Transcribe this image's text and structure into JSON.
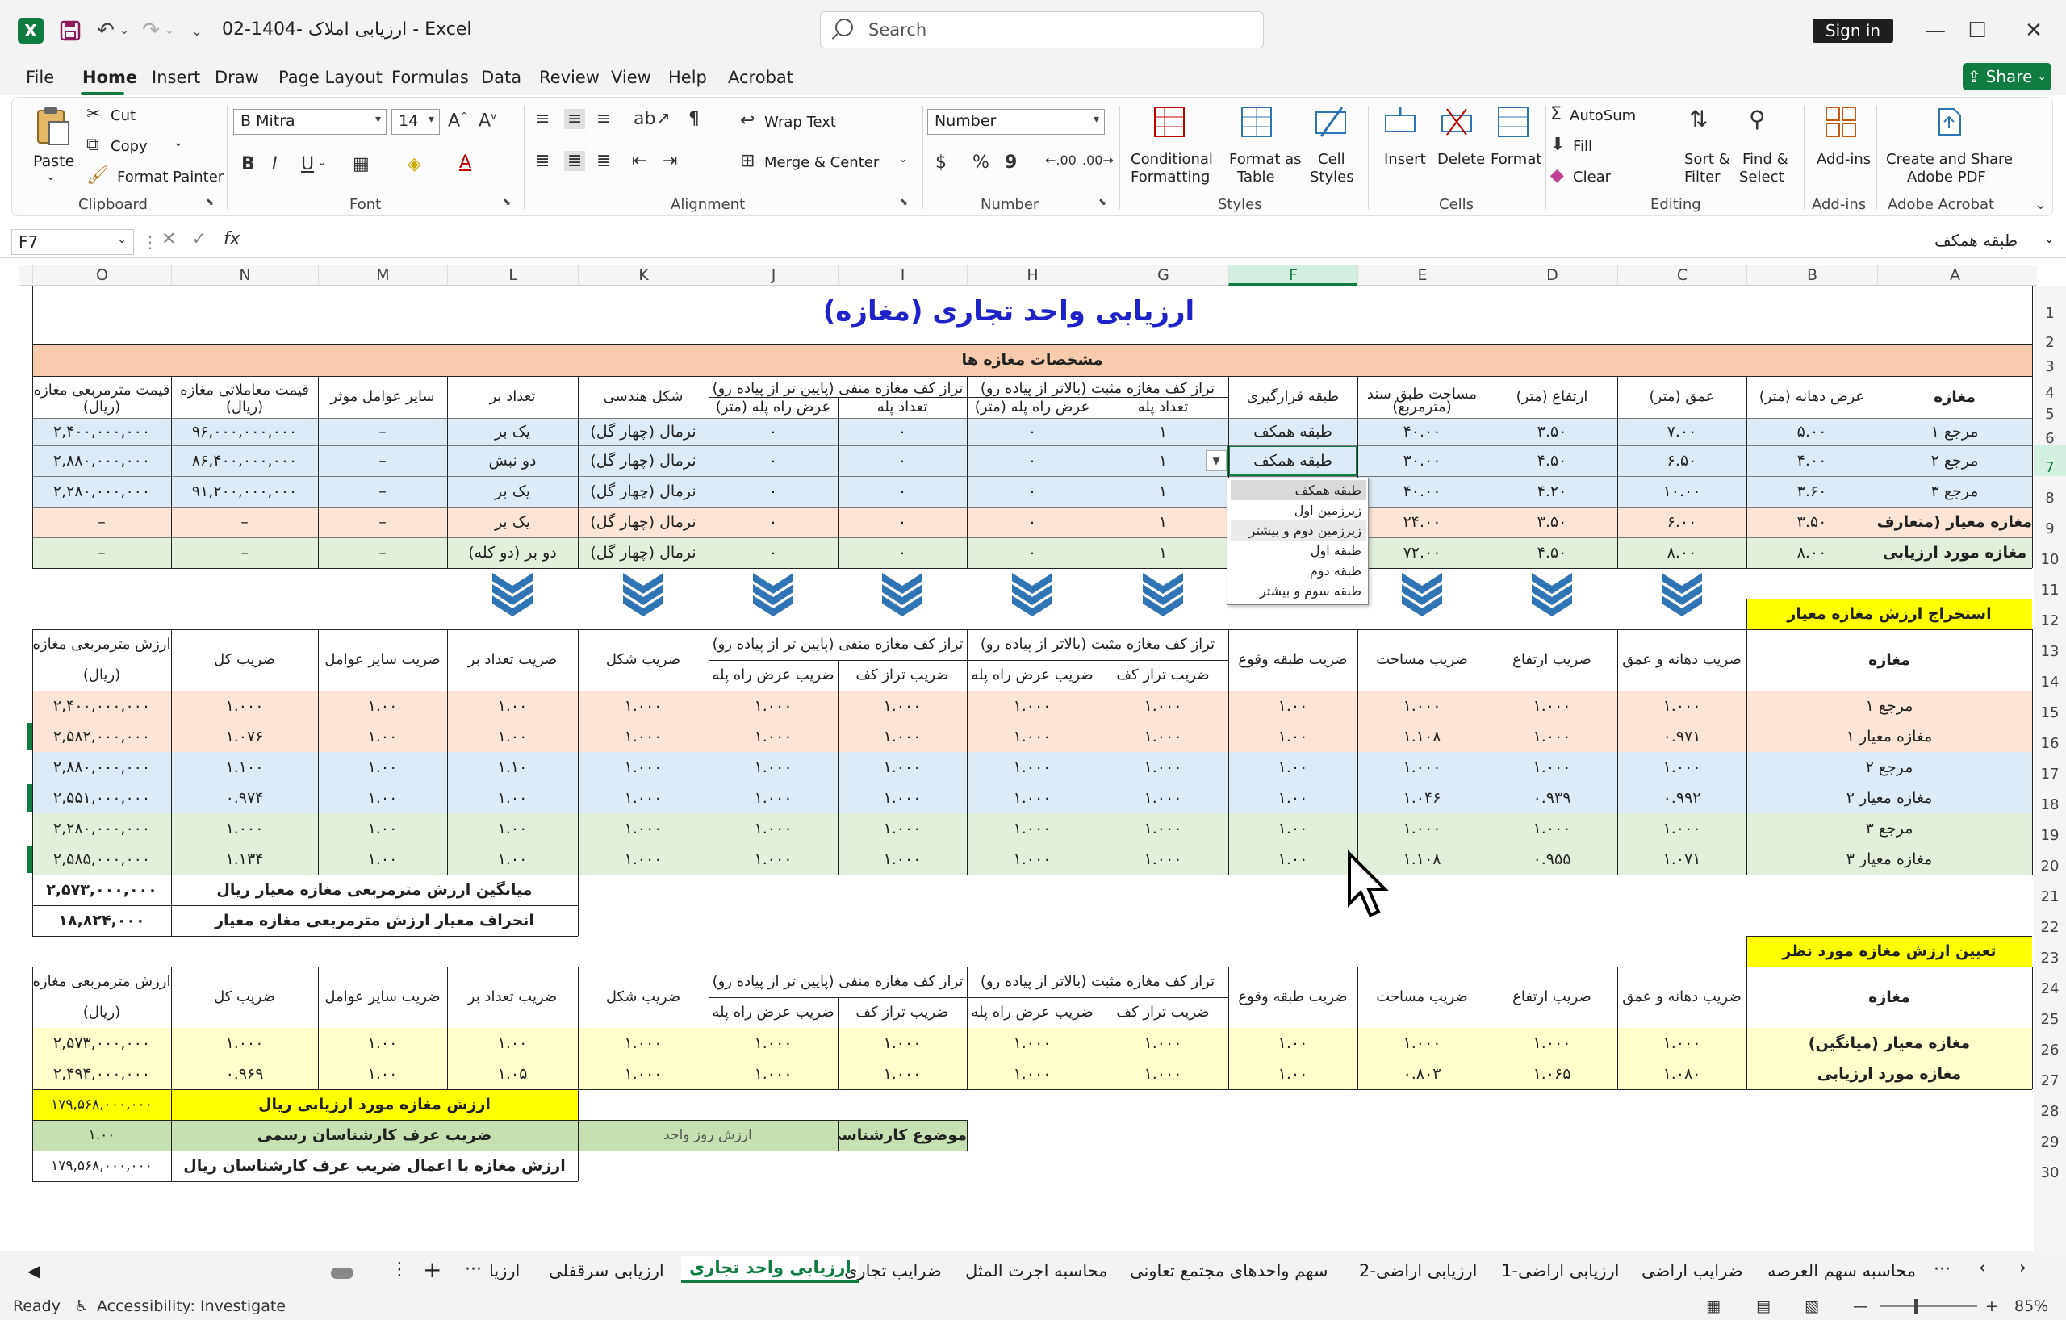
{
  "app": {
    "title": "ارزیابی املاک -1404-02  -  Excel",
    "search_placeholder": "Search",
    "signin_label": "Sign in",
    "share_label": "Share",
    "accent": "#107c41"
  },
  "menu": [
    "File",
    "Home",
    "Insert",
    "Draw",
    "Page Layout",
    "Formulas",
    "Data",
    "Review",
    "View",
    "Help",
    "Acrobat"
  ],
  "ribbon": {
    "clipboard": {
      "paste": "Paste",
      "cut": "Cut",
      "copy": "Copy",
      "format_painter": "Format Painter",
      "group": "Clipboard"
    },
    "font": {
      "name": "B Mitra",
      "size": "14",
      "group": "Font"
    },
    "alignment": {
      "wrap": "Wrap Text",
      "merge": "Merge & Center",
      "group": "Alignment"
    },
    "number": {
      "format": "Number",
      "group": "Number"
    },
    "styles": {
      "conditional": "Conditional",
      "conditional2": "Formatting",
      "format_table": "Format as",
      "format_table2": "Table",
      "cell_styles": "Cell",
      "cell_styles2": "Styles",
      "group": "Styles"
    },
    "cells": {
      "insert": "Insert",
      "delete": "Delete",
      "format": "Format",
      "group": "Cells"
    },
    "editing": {
      "autosum": "AutoSum",
      "fill": "Fill",
      "clear": "Clear",
      "sort": "Sort &",
      "sort2": "Filter",
      "find": "Find &",
      "find2": "Select",
      "group": "Editing"
    },
    "addins": {
      "label": "Add-ins",
      "group": "Add-ins"
    },
    "acrobat": {
      "label": "Create and Share",
      "label2": "Adobe PDF",
      "group": "Adobe Acrobat"
    }
  },
  "formula_bar": {
    "name_box": "F7",
    "fx": "fx",
    "value": "طبقه همکف"
  },
  "columns": [
    "O",
    "N",
    "M",
    "L",
    "K",
    "J",
    "I",
    "H",
    "G",
    "F",
    "E",
    "D",
    "C",
    "B",
    "A"
  ],
  "rows": [
    "1",
    "2",
    "3",
    "4",
    "5",
    "6",
    "7",
    "8",
    "9",
    "10",
    "11",
    "12",
    "13",
    "14",
    "15",
    "16",
    "17",
    "18",
    "19",
    "20",
    "21",
    "22",
    "23",
    "24",
    "25",
    "26",
    "27",
    "28",
    "29",
    "30"
  ],
  "sheet": {
    "title": "ارزیابی واحد تجاری (مغازه)",
    "specs_header": "مشخصات مغازه ها",
    "spec_headers": {
      "shop": "مغازه",
      "frontage": "عرض دهانه (متر)",
      "depth": "عمق (متر)",
      "height": "ارتفاع (متر)",
      "area": "مساحت طبق سند",
      "area_unit": "(مترمربع)",
      "floor": "طبقه قرارگیری",
      "pos_level": "تراز کف مغازه مثبت (بالاتر از پیاده رو)",
      "neg_level": "تراز کف مغازه منفی (پایین تر از پیاده رو)",
      "steps": "تعداد پله",
      "step_width": "عرض راه پله (متر)",
      "shape": "شکل هندسی",
      "sides": "تعداد بر",
      "other": "سایر عوامل موثر",
      "deal_price": "قیمت معاملاتی مغازه",
      "unit_price": "قیمت مترمربعی مغازه",
      "rial": "(ریال)"
    },
    "spec_rows": [
      {
        "shop": "مرجع ۱",
        "frontage": "۵.۰۰",
        "depth": "۷.۰۰",
        "height": "۳.۵۰",
        "area": "۴۰.۰۰",
        "floor": "طبقه همکف",
        "psteps": "۱",
        "pwidth": "۰",
        "nsteps": "۰",
        "nwidth": "۰",
        "shape": "نرمال (چهار گل)",
        "sides": "یک بر",
        "other": "–",
        "deal": "۹۶,۰۰۰,۰۰۰,۰۰۰",
        "unit": "۲,۴۰۰,۰۰۰,۰۰۰"
      },
      {
        "shop": "مرجع ۲",
        "frontage": "۴.۰۰",
        "depth": "۶.۵۰",
        "height": "۴.۵۰",
        "area": "۳۰.۰۰",
        "floor": "طبقه همکف",
        "psteps": "۱",
        "pwidth": "۰",
        "nsteps": "۰",
        "nwidth": "۰",
        "shape": "نرمال (چهار گل)",
        "sides": "دو نبش",
        "other": "–",
        "deal": "۸۶,۴۰۰,۰۰۰,۰۰۰",
        "unit": "۲,۸۸۰,۰۰۰,۰۰۰"
      },
      {
        "shop": "مرجع ۳",
        "frontage": "۳.۶۰",
        "depth": "۱۰.۰۰",
        "height": "۴.۲۰",
        "area": "۴۰.۰۰",
        "floor": "",
        "psteps": "۱",
        "pwidth": "۰",
        "nsteps": "۰",
        "nwidth": "۰",
        "shape": "نرمال (چهار گل)",
        "sides": "یک بر",
        "other": "–",
        "deal": "۹۱,۲۰۰,۰۰۰,۰۰۰",
        "unit": "۲,۲۸۰,۰۰۰,۰۰۰"
      },
      {
        "shop": "مغازه معیار (متعارف)",
        "frontage": "۳.۵۰",
        "depth": "۶.۰۰",
        "height": "۳.۵۰",
        "area": "۲۴.۰۰",
        "floor": "",
        "psteps": "۱",
        "pwidth": "۰",
        "nsteps": "۰",
        "nwidth": "۰",
        "shape": "نرمال (چهار گل)",
        "sides": "یک بر",
        "other": "–",
        "deal": "–",
        "unit": "–"
      },
      {
        "shop": "مغازه مورد ارزیابی",
        "frontage": "۸.۰۰",
        "depth": "۸.۰۰",
        "height": "۴.۵۰",
        "area": "۷۲.۰۰",
        "floor": "",
        "psteps": "۱",
        "pwidth": "۰",
        "nsteps": "۰",
        "nwidth": "۰",
        "shape": "نرمال (چهار گل)",
        "sides": "دو بر (دو کله)",
        "other": "–",
        "deal": "–",
        "unit": "–"
      }
    ],
    "dropdown": [
      "طبقه همکف",
      "زیرزمین اول",
      "زیرزمین دوم و بیشتر",
      "طبقه اول",
      "طبقه دوم",
      "طبقه سوم و بیشتر"
    ],
    "extract_label": "استخراج ارزش مغازه معیار",
    "coef_headers": {
      "shop": "مغازه",
      "frontage_depth": "ضریب دهانه و عمق",
      "height": "ضریب ارتفاع",
      "area": "ضریب مساحت",
      "floor": "ضریب طبقه وقوع",
      "pos_level": "تراز کف مغازه مثبت (بالاتر از پیاده رو)",
      "neg_level": "تراز کف مغازه منفی (پایین تر از پیاده رو)",
      "level_coef": "ضریب تراز کف",
      "width_coef": "ضریب عرض راه پله",
      "shape": "ضریب شکل",
      "sides": "ضریب تعداد بر",
      "other": "ضریب سایر عوامل",
      "total": "ضریب کل",
      "unit_value": "ارزش مترمربعی مغازه",
      "rial": "(ریال)"
    },
    "coef_rows": [
      {
        "shop": "مرجع ۱",
        "fd": "۱.۰۰۰",
        "h": "۱.۰۰۰",
        "a": "۱.۰۰۰",
        "f": "۱.۰۰",
        "pl": "۱.۰۰۰",
        "pw": "۱.۰۰۰",
        "nl": "۱.۰۰۰",
        "nw": "۱.۰۰۰",
        "sh": "۱.۰۰۰",
        "sd": "۱.۰۰",
        "o": "۱.۰۰",
        "t": "۱.۰۰۰",
        "v": "۲,۴۰۰,۰۰۰,۰۰۰",
        "bg": "#fce4d6"
      },
      {
        "shop": "مغازه معیار ۱",
        "fd": "۰.۹۷۱",
        "h": "۱.۰۰۰",
        "a": "۱.۱۰۸",
        "f": "۱.۰۰",
        "pl": "۱.۰۰۰",
        "pw": "۱.۰۰۰",
        "nl": "۱.۰۰۰",
        "nw": "۱.۰۰۰",
        "sh": "۱.۰۰۰",
        "sd": "۱.۰۰",
        "o": "۱.۰۰",
        "t": "۱.۰۷۶",
        "v": "۲,۵۸۲,۰۰۰,۰۰۰",
        "bg": "#fce4d6"
      },
      {
        "shop": "مرجع ۲",
        "fd": "۱.۰۰۰",
        "h": "۱.۰۰۰",
        "a": "۱.۰۰۰",
        "f": "۱.۰۰",
        "pl": "۱.۰۰۰",
        "pw": "۱.۰۰۰",
        "nl": "۱.۰۰۰",
        "nw": "۱.۰۰۰",
        "sh": "۱.۰۰۰",
        "sd": "۱.۱۰",
        "o": "۱.۰۰",
        "t": "۱.۱۰۰",
        "v": "۲,۸۸۰,۰۰۰,۰۰۰",
        "bg": "#ddebf7"
      },
      {
        "shop": "مغازه معیار ۲",
        "fd": "۰.۹۹۲",
        "h": "۰.۹۳۹",
        "a": "۱.۰۴۶",
        "f": "۱.۰۰",
        "pl": "۱.۰۰۰",
        "pw": "۱.۰۰۰",
        "nl": "۱.۰۰۰",
        "nw": "۱.۰۰۰",
        "sh": "۱.۰۰۰",
        "sd": "۱.۰۰",
        "o": "۱.۰۰",
        "t": "۰.۹۷۴",
        "v": "۲,۵۵۱,۰۰۰,۰۰۰",
        "bg": "#ddebf7"
      },
      {
        "shop": "مرجع ۳",
        "fd": "۱.۰۰۰",
        "h": "۱.۰۰۰",
        "a": "۱.۰۰۰",
        "f": "۱.۰۰",
        "pl": "۱.۰۰۰",
        "pw": "۱.۰۰۰",
        "nl": "۱.۰۰۰",
        "nw": "۱.۰۰۰",
        "sh": "۱.۰۰۰",
        "sd": "۱.۰۰",
        "o": "۱.۰۰",
        "t": "۱.۰۰۰",
        "v": "۲,۲۸۰,۰۰۰,۰۰۰",
        "bg": "#e2efda"
      },
      {
        "shop": "مغازه معیار ۳",
        "fd": "۱.۰۷۱",
        "h": "۰.۹۵۵",
        "a": "۱.۱۰۸",
        "f": "۱.۰۰",
        "pl": "۱.۰۰۰",
        "pw": "۱.۰۰۰",
        "nl": "۱.۰۰۰",
        "nw": "۱.۰۰۰",
        "sh": "۱.۰۰۰",
        "sd": "۱.۰۰",
        "o": "۱.۰۰",
        "t": "۱.۱۳۴",
        "v": "۲,۵۸۵,۰۰۰,۰۰۰",
        "bg": "#e2efda"
      }
    ],
    "summary": {
      "avg_label": "میانگین ارزش مترمربعی مغازه معیار   ریال",
      "avg_value": "۲,۵۷۳,۰۰۰,۰۰۰",
      "dev_label": "انحراف معیار ارزش مترمربعی مغازه معیار",
      "dev_value": "۱۸,۸۲۴,۰۰۰"
    },
    "determine_label": "تعیین ارزش مغازه مورد نظر",
    "final_rows": [
      {
        "shop": "مغازه معیار (میانگین)",
        "fd": "۱.۰۰۰",
        "h": "۱.۰۰۰",
        "a": "۱.۰۰۰",
        "f": "۱.۰۰",
        "pl": "۱.۰۰۰",
        "pw": "۱.۰۰۰",
        "nl": "۱.۰۰۰",
        "nw": "۱.۰۰۰",
        "sh": "۱.۰۰۰",
        "sd": "۱.۰۰",
        "o": "۱.۰۰",
        "t": "۱.۰۰۰",
        "v": "۲,۵۷۳,۰۰۰,۰۰۰"
      },
      {
        "shop": "مغازه مورد ارزیابی",
        "fd": "۱.۰۸۰",
        "h": "۱.۰۶۵",
        "a": "۰.۸۰۳",
        "f": "۱.۰۰",
        "pl": "۱.۰۰۰",
        "pw": "۱.۰۰۰",
        "nl": "۱.۰۰۰",
        "nw": "۱.۰۰۰",
        "sh": "۱.۰۰۰",
        "sd": "۱.۰۵",
        "o": "۱.۰۰",
        "t": "۰.۹۶۹",
        "v": "۲,۴۹۴,۰۰۰,۰۰۰"
      }
    ],
    "result": {
      "value_label": "ارزش مغازه مورد ارزیابی   ریال",
      "value": "۱۷۹,۵۶۸,۰۰۰,۰۰۰",
      "coef_label": "ضریب عرف کارشناسان رسمی",
      "coef_value": "۱.۰۰",
      "subject_label": "موضوع کارشناسی",
      "subject_value": "ارزش روز واحد",
      "final_label": "ارزش مغازه با اعمال ضریب عرف کارشناسان   ریال",
      "final_value": "۱۷۹,۵۶۸,۰۰۰,۰۰۰"
    }
  },
  "tabs": [
    "ارزیا",
    "ارزیابی سرقفلی",
    "ارزیابی واحد تجاری",
    "ضرایب تجاری",
    "محاسبه اجرت المثل",
    "سهم واحدهای مجتمع تعاونی",
    "ارزیابی اراضی-2",
    "ارزیابی اراضی-1",
    "ضرایب اراضی",
    "محاسبه سهم العرصه"
  ],
  "active_tab": "ارزیابی واحد تجاری",
  "status": {
    "ready": "Ready",
    "accessibility": "Accessibility: Investigate",
    "zoom": "85%"
  },
  "colors": {
    "orange_band": "#fce4d6",
    "blue_band": "#ddebf7",
    "green_band": "#e2efda",
    "yellow": "#ffff00",
    "light_yellow": "#ffffcc",
    "title_blue": "#1e22c8",
    "chevron": "#2f75b5"
  }
}
